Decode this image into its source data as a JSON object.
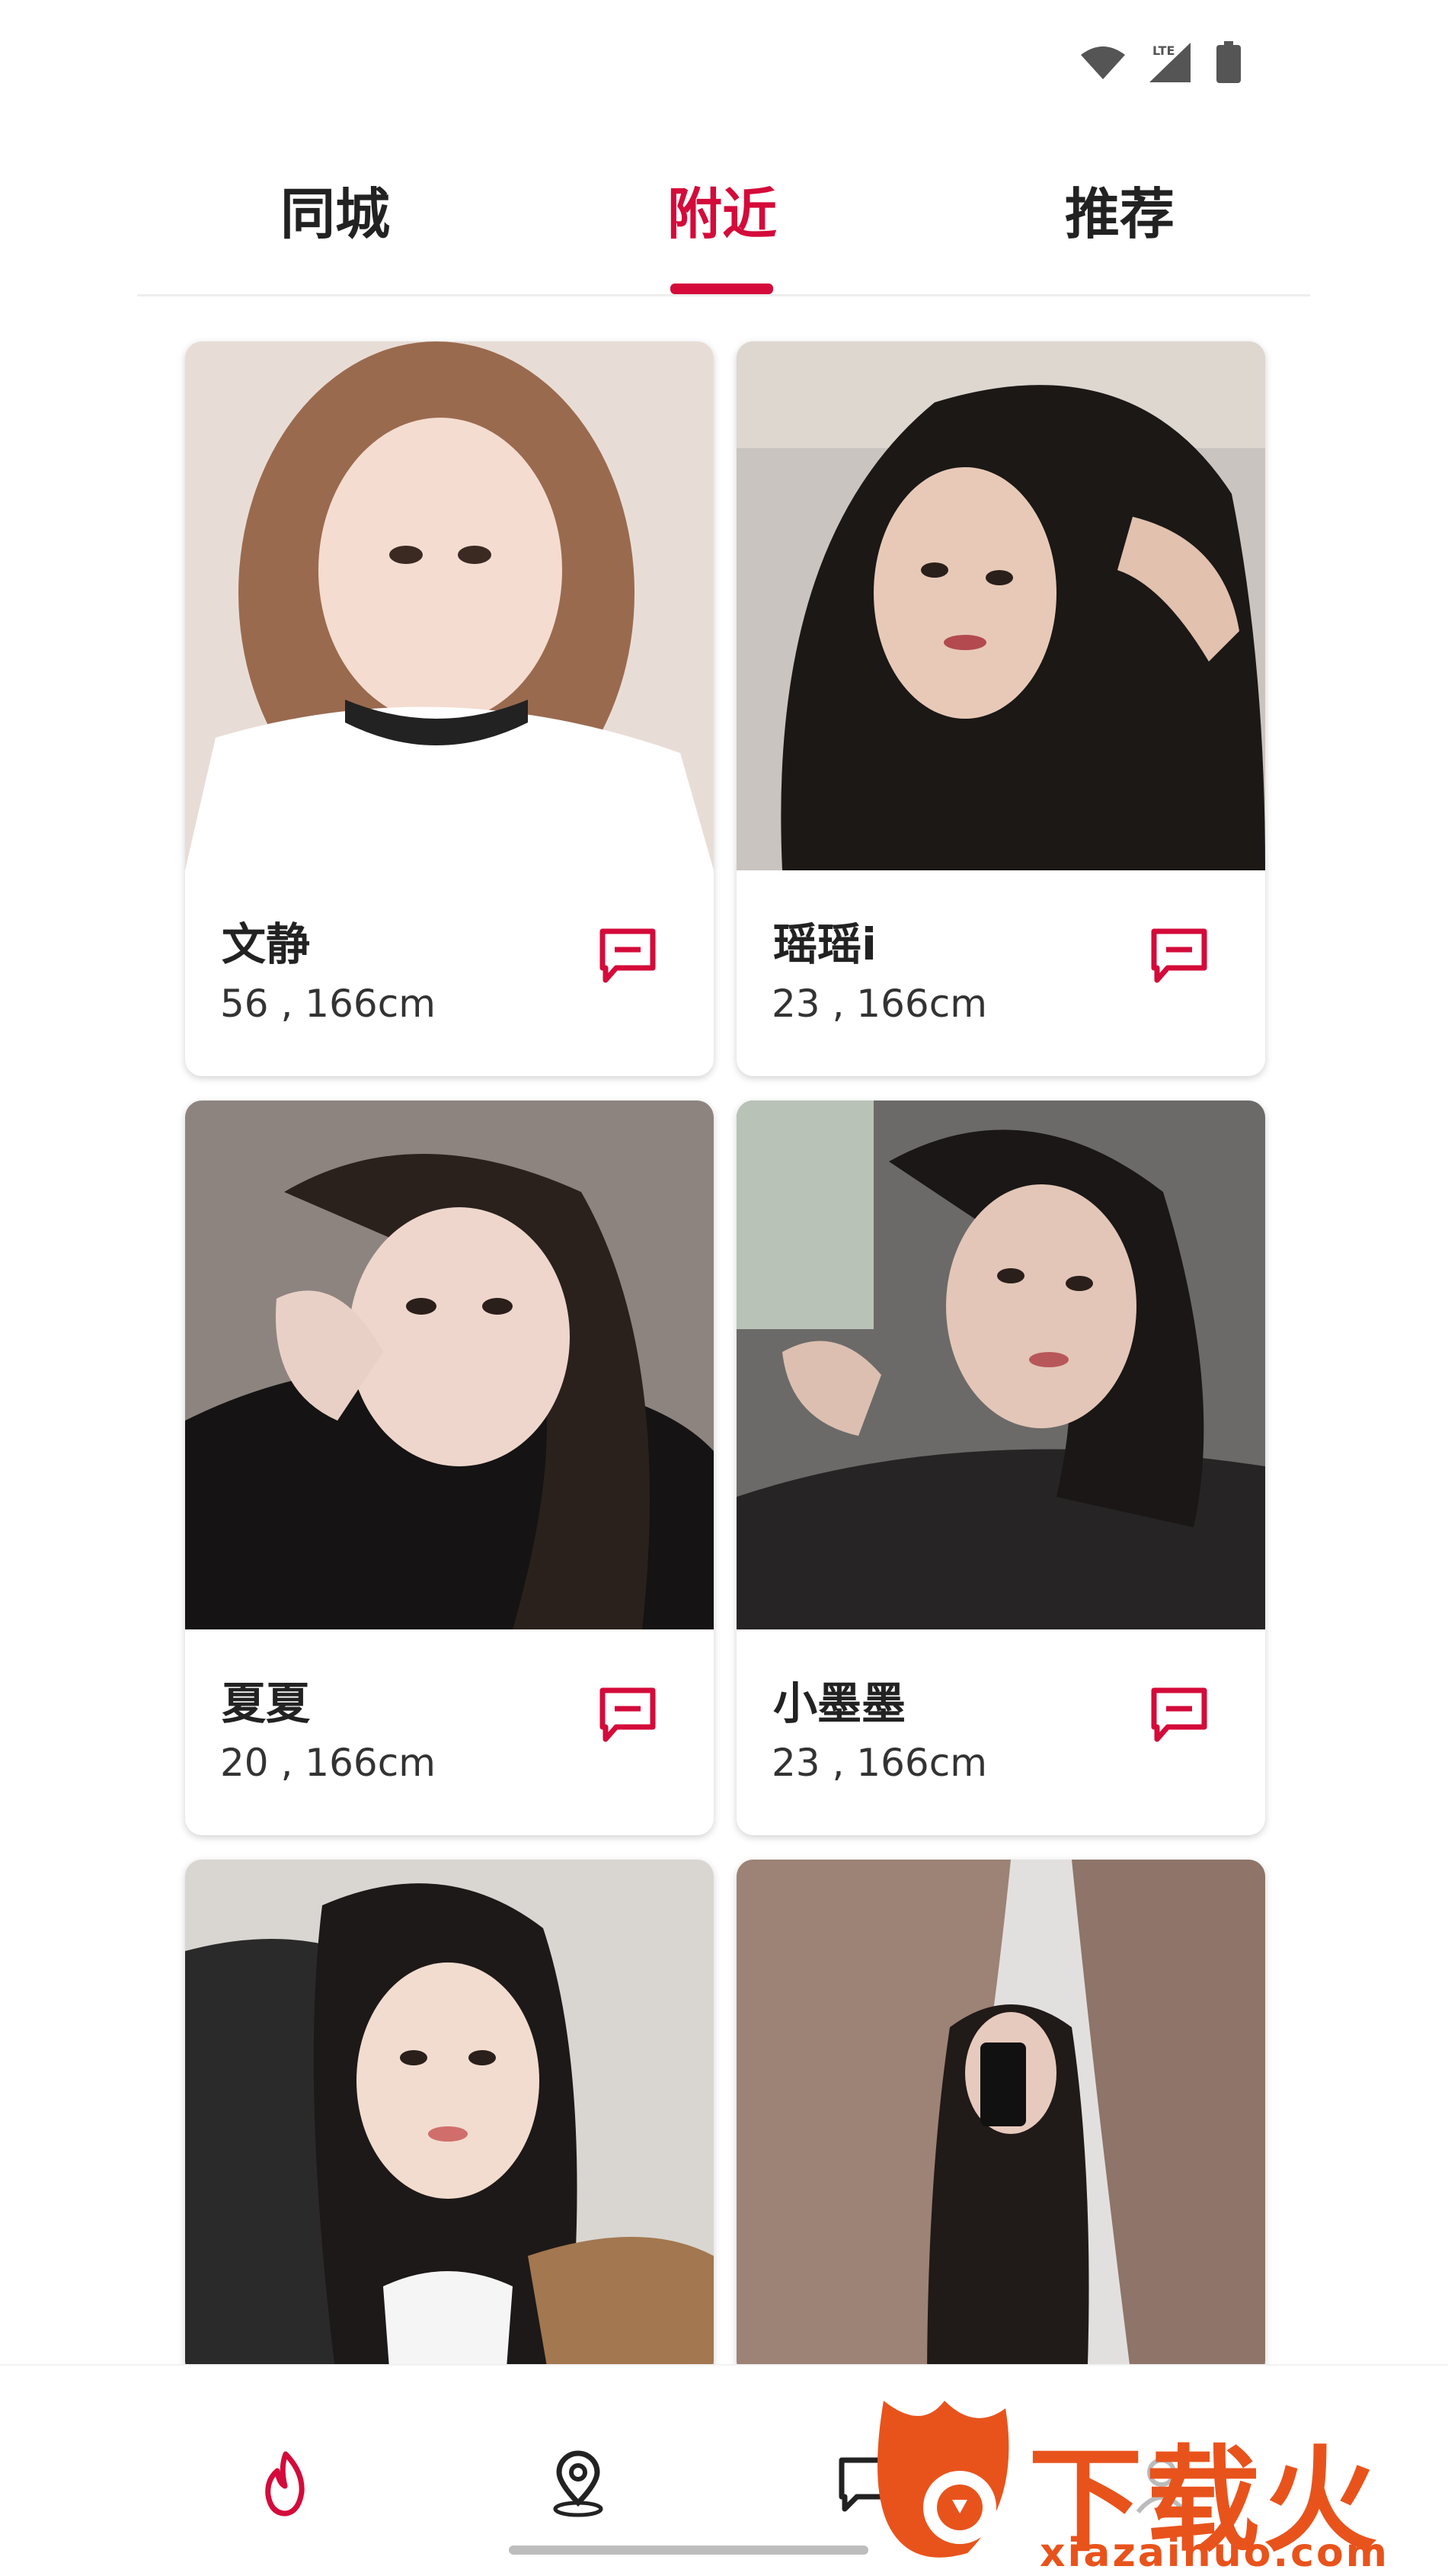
{
  "status_bar": {
    "network": "LTE",
    "icons": [
      "wifi-icon",
      "signal-icon",
      "battery-icon"
    ]
  },
  "tabs": [
    {
      "label": "同城",
      "active": false
    },
    {
      "label": "附近",
      "active": true
    },
    {
      "label": "推荐",
      "active": false
    }
  ],
  "accent_color": "#d40b3a",
  "profiles": [
    {
      "name": "文静",
      "info": "56 , 166cm"
    },
    {
      "name": "瑶瑶i",
      "info": "23 , 166cm"
    },
    {
      "name": "夏夏",
      "info": "20 , 166cm"
    },
    {
      "name": "小墨墨",
      "info": "23 , 166cm"
    },
    {
      "name": "",
      "info": ""
    },
    {
      "name": "",
      "info": ""
    }
  ],
  "bottom_nav": [
    {
      "icon": "flame-icon",
      "active": true
    },
    {
      "icon": "location-pin-icon",
      "active": false
    },
    {
      "icon": "chat-icon",
      "active": false
    },
    {
      "icon": "profile-icon",
      "active": false
    }
  ],
  "watermark": {
    "title": "下载火",
    "url": "xiazaihuo.com"
  }
}
